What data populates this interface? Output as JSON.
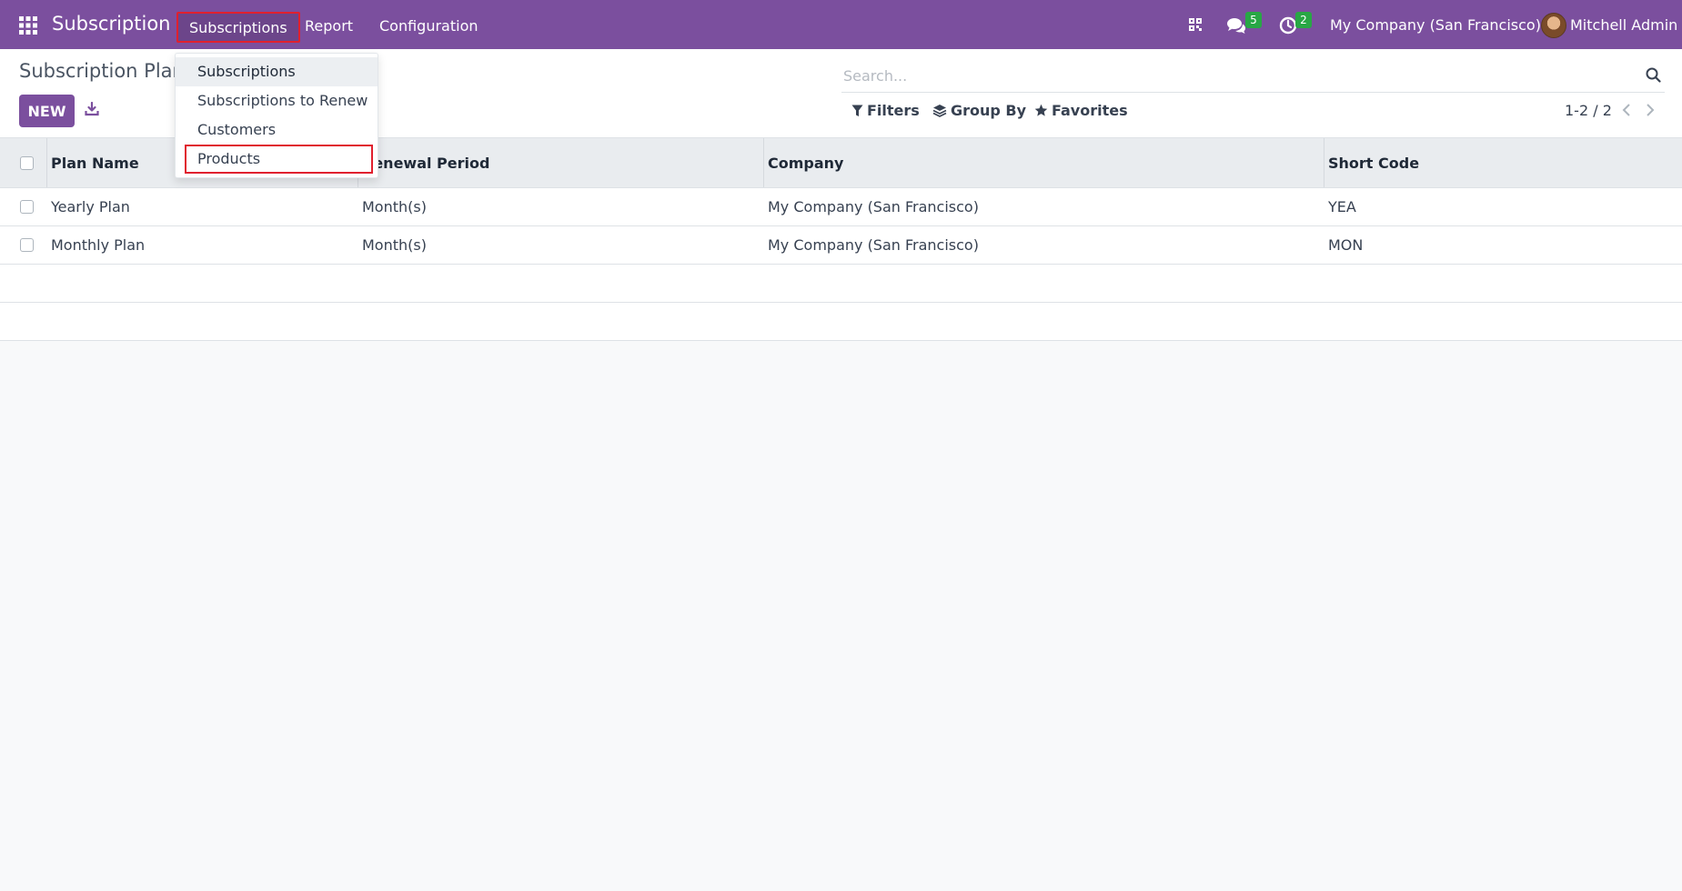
{
  "navbar": {
    "app_name": "Subscription",
    "menus": [
      "Subscriptions",
      "Report",
      "Configuration"
    ],
    "messages_badge": "5",
    "activities_badge": "2",
    "company": "My Company (San Francisco)",
    "user": "Mitchell Admin",
    "colors": {
      "bar": "#7b4f9e",
      "badge": "#28a745",
      "highlight": "#e0202e"
    },
    "icons": [
      "apps-grid-icon",
      "qr-code-icon",
      "chat-icon",
      "clock-icon",
      "avatar"
    ]
  },
  "dropdown": {
    "items": [
      "Subscriptions",
      "Subscriptions to Renew",
      "Customers",
      "Products"
    ]
  },
  "control_panel": {
    "breadcrumb": "Subscription Plan",
    "new_label": "NEW",
    "search_placeholder": "Search...",
    "filters_label": "Filters",
    "group_by_label": "Group By",
    "favorites_label": "Favorites",
    "pager": "1-2 / 2"
  },
  "table": {
    "headers": [
      "Plan Name",
      "Renewal Period",
      "Company",
      "Short Code"
    ],
    "rows": [
      [
        "Yearly Plan",
        "Month(s)",
        "My Company (San Francisco)",
        "YEA"
      ],
      [
        "Monthly Plan",
        "Month(s)",
        "My Company (San Francisco)",
        "MON"
      ]
    ]
  }
}
